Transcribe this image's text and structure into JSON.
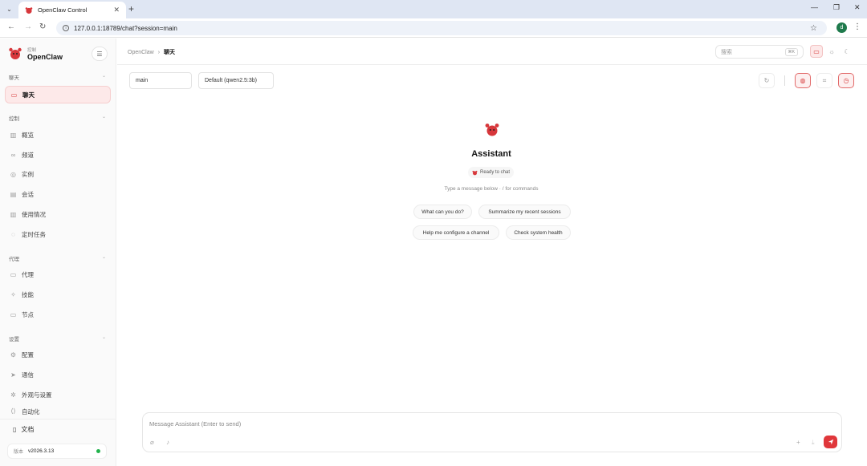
{
  "browser": {
    "tab_title": "OpenClaw Control",
    "url": "127.0.0.1:18789/chat?session=main",
    "profile_initial": "d"
  },
  "sidebar": {
    "brand_sub": "控制",
    "brand_name": "OpenClaw",
    "sections": {
      "chat": "聊天",
      "control": "控制",
      "agent": "代理",
      "settings": "设置"
    },
    "items": {
      "chat": "聊天",
      "overview": "概览",
      "channels": "频道",
      "instances": "实例",
      "sessions": "会话",
      "usage": "使用情况",
      "cron": "定时任务",
      "agents": "代理",
      "skills": "技能",
      "nodes": "节点",
      "config": "配置",
      "comms": "通信",
      "appearance": "外观与设置",
      "partial": "自动化"
    },
    "docs": "文档",
    "version_label": "版本",
    "version_value": "v2026.3.13"
  },
  "header": {
    "crumb_root": "OpenClaw",
    "crumb_current": "聊天",
    "search_placeholder": "搜索",
    "search_kbd": "⌘K"
  },
  "session_bar": {
    "session": "main",
    "model": "Default (qwen2.5:3b)"
  },
  "welcome": {
    "title": "Assistant",
    "status": "Ready to chat",
    "hint": "Type a message below · / for commands",
    "suggestions": [
      "What can you do?",
      "Summarize my recent sessions",
      "Help me configure a channel",
      "Check system health"
    ]
  },
  "composer": {
    "placeholder": "Message Assistant (Enter to send)"
  },
  "colors": {
    "accent": "#e0373b",
    "active_bg": "#fde9e9",
    "status_online": "#22b24c"
  }
}
